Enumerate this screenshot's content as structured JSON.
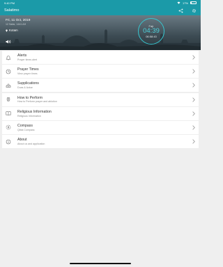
{
  "status_bar": {
    "time": "9:40 PM",
    "date": "Fri 11 Oct",
    "battery": "17%",
    "battery_level": 0.17
  },
  "header": {
    "title": "Salatimo",
    "share_icon": "share-icon",
    "settings_icon": "gear-icon"
  },
  "hero": {
    "date": "Fri, 11 Oct, 2019",
    "hijri": "12 Safar, 1441 AH",
    "location": "Kotam",
    "prayer_clock": {
      "prayer": "Fajr",
      "time": "04:39",
      "countdown": "06:58:43"
    }
  },
  "menu": [
    {
      "icon": "bell-icon",
      "title": "Alerts",
      "subtitle": "Prayer times alert"
    },
    {
      "icon": "clock-icon",
      "title": "Prayer Times",
      "subtitle": "View prayer times"
    },
    {
      "icon": "mosque-icon",
      "title": "Supplications",
      "subtitle": "Duas & Azkar"
    },
    {
      "icon": "hands-icon",
      "title": "How to Perform",
      "subtitle": "How to Perform prayer and ablution"
    },
    {
      "icon": "book-icon",
      "title": "Religious Information",
      "subtitle": "Religious Information"
    },
    {
      "icon": "compass-icon",
      "title": "Compass",
      "subtitle": "Qibla Compass"
    },
    {
      "icon": "info-icon",
      "title": "About",
      "subtitle": "About us and application"
    }
  ]
}
